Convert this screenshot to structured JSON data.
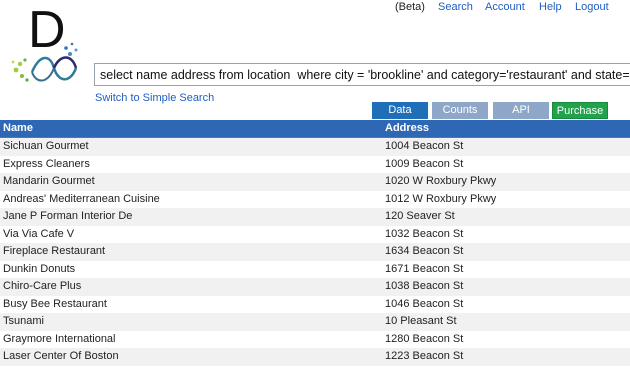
{
  "nav": {
    "beta": "(Beta)",
    "search": "Search",
    "account": "Account",
    "help": "Help",
    "logout": "Logout"
  },
  "logo": {
    "letter": "D"
  },
  "query": {
    "value": "select name address from location  where city = 'brookline' and category='restaurant' and state='ma'"
  },
  "switch_label": "Switch to Simple Search",
  "tabs": {
    "data": "Data",
    "counts": "Counts",
    "api": "API",
    "purchase": "Purchase"
  },
  "table": {
    "headers": {
      "name": "Name",
      "address": "Address"
    },
    "rows": [
      {
        "name": "Sichuan Gourmet",
        "address": "1004 Beacon St"
      },
      {
        "name": "Express Cleaners",
        "address": "1009 Beacon St"
      },
      {
        "name": "Mandarin Gourmet",
        "address": "1020 W Roxbury Pkwy"
      },
      {
        "name": "Andreas' Mediterranean Cuisine",
        "address": "1012 W Roxbury Pkwy"
      },
      {
        "name": "Jane P Forman Interior De",
        "address": "120 Seaver St"
      },
      {
        "name": "Via Via Cafe V",
        "address": "1032 Beacon St"
      },
      {
        "name": "Fireplace Restaurant",
        "address": "1634 Beacon St"
      },
      {
        "name": "Dunkin Donuts",
        "address": "1671 Beacon St"
      },
      {
        "name": "Chiro-Care Plus",
        "address": "1038 Beacon St"
      },
      {
        "name": "Busy Bee Restaurant",
        "address": "1046 Beacon St"
      },
      {
        "name": "Tsunami",
        "address": "10 Pleasant St"
      },
      {
        "name": "Graymore International",
        "address": "1280 Beacon St"
      },
      {
        "name": "Laser Center Of Boston",
        "address": "1223 Beacon St"
      }
    ]
  }
}
